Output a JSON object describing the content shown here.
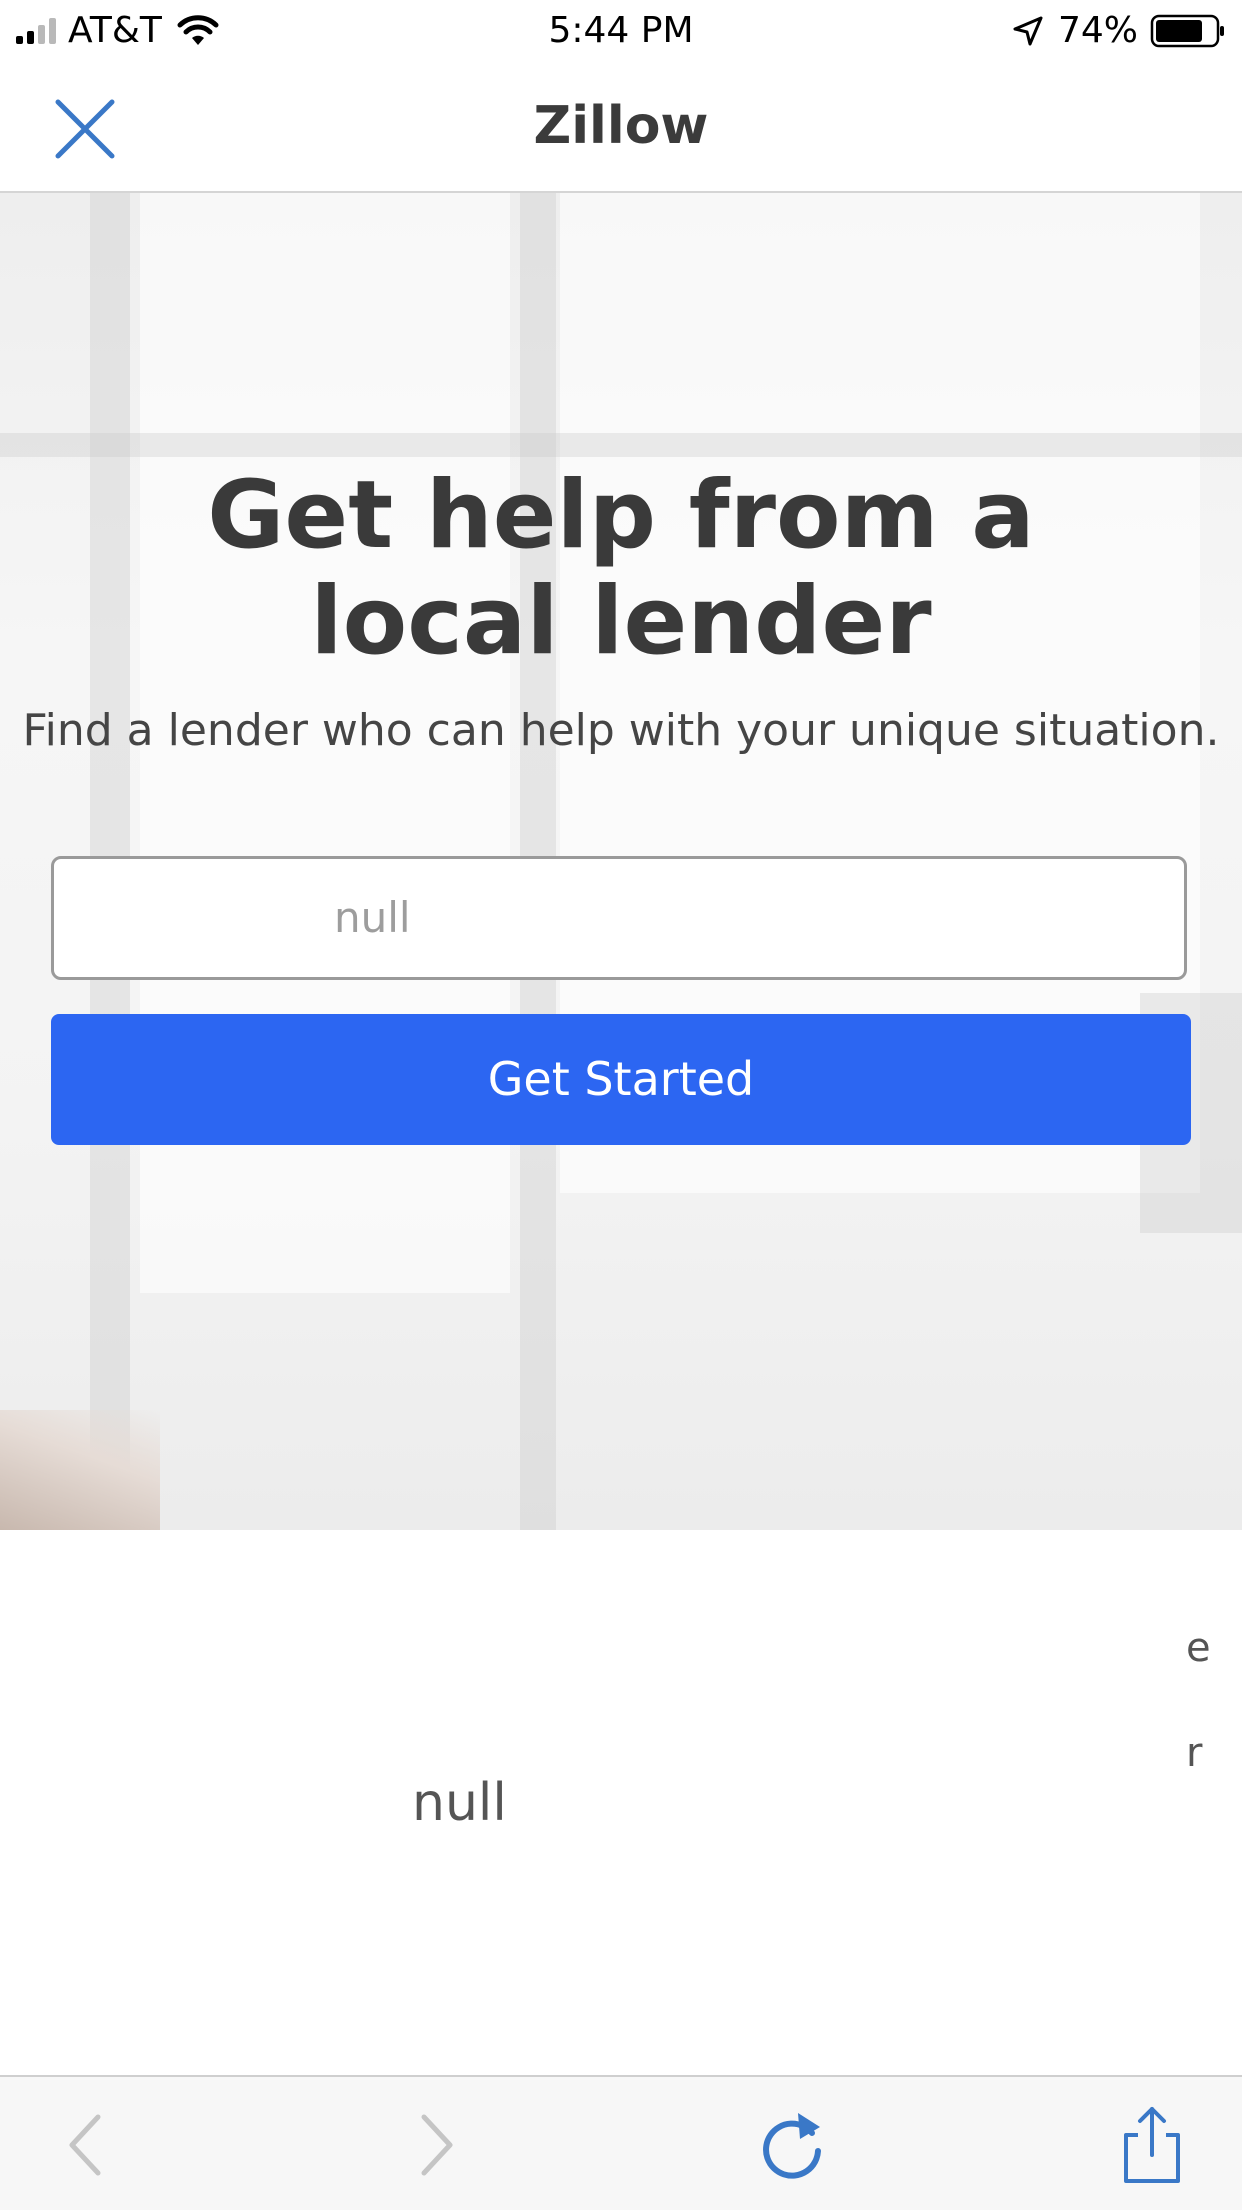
{
  "status_bar": {
    "carrier": "AT&T",
    "time": "5:44 PM",
    "battery_percent": "74%",
    "icons": [
      "signal-icon",
      "wifi-icon",
      "location-arrow-icon",
      "battery-icon"
    ]
  },
  "nav": {
    "title": "Zillow",
    "close_icon": "close-icon"
  },
  "hero": {
    "headline_line1": "Get help from a",
    "headline_line2": "local lender",
    "subheadline": "Find a lender who can help with your unique situation.",
    "zip_input": {
      "placeholder": "null",
      "value": ""
    },
    "cta_label": "Get Started"
  },
  "lower": {
    "content_text": "null",
    "edge_text_1": "e",
    "edge_text_2": "r"
  },
  "toolbar": {
    "icons": [
      "back-icon",
      "forward-icon",
      "reload-icon",
      "share-icon"
    ]
  },
  "colors": {
    "accent_blue": "#2c66f2",
    "icon_blue": "#3a78c7",
    "disabled_gray": "#c5c5c5",
    "text_dark": "#3a3a3a"
  }
}
